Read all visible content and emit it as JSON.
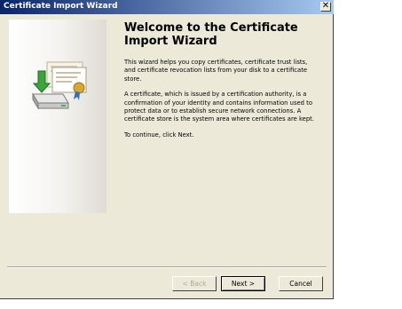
{
  "window": {
    "title": "Certificate Import Wizard",
    "close_glyph": "✕"
  },
  "welcome": {
    "heading": "Welcome to the Certificate Import Wizard",
    "paragraphs": [
      "This wizard helps you copy certificates, certificate trust lists, and certificate revocation lists from your disk to a certificate store.",
      "A certificate, which is issued by a certification authority, is a confirmation of your identity and contains information used to protect data or to establish secure network connections. A certificate store is the system area where certificates are kept.",
      "To continue, click Next."
    ]
  },
  "buttons": {
    "back": "< Back",
    "next": "Next >",
    "cancel": "Cancel"
  },
  "icons": {
    "sidebar_art": "certificate-import-icon",
    "close": "close-icon"
  },
  "colors": {
    "titlebar_start": "#0a246a",
    "titlebar_end": "#a6caf0",
    "dialog_bg": "#ece9d8"
  }
}
